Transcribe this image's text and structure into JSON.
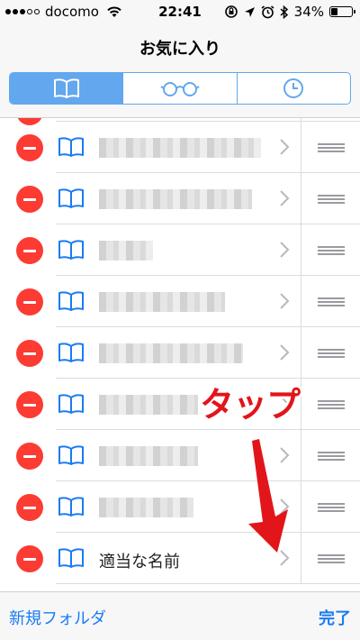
{
  "status_bar": {
    "carrier": "docomo",
    "time": "22:41",
    "battery": "34%",
    "battery_fraction": 0.34
  },
  "nav": {
    "title": "お気に入り",
    "tabs": [
      {
        "icon": "book-icon",
        "selected": true
      },
      {
        "icon": "reading-list-glasses-icon",
        "selected": false
      },
      {
        "icon": "history-clock-icon",
        "selected": false
      }
    ]
  },
  "bookmarks": [
    {
      "title": "",
      "blurred": true
    },
    {
      "title": "",
      "blurred": true
    },
    {
      "title": "",
      "blurred": true
    },
    {
      "title": "",
      "blurred": true
    },
    {
      "title": "",
      "blurred": true
    },
    {
      "title": "",
      "blurred": true
    },
    {
      "title": "",
      "blurred": true
    },
    {
      "title": "",
      "blurred": true
    },
    {
      "title": "適当な名前",
      "blurred": false
    }
  ],
  "annotation": {
    "text": "タップ",
    "color": "#e2151a"
  },
  "toolbar": {
    "new_folder": "新規フォルダ",
    "done": "完了"
  },
  "colors": {
    "accent": "#1a7bf2",
    "segment": "#63a7ee",
    "delete": "#fc3b33"
  }
}
